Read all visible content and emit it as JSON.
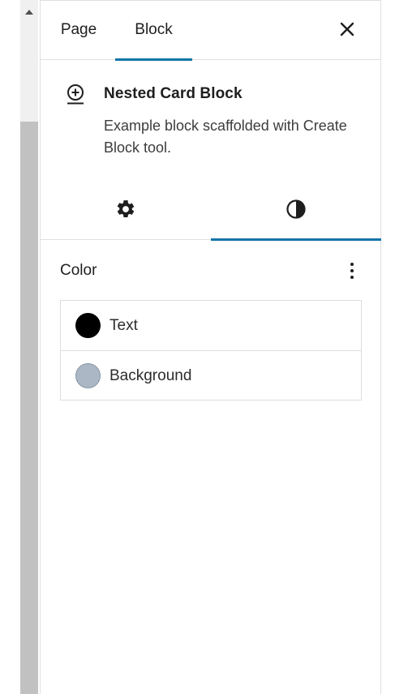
{
  "header": {
    "tabs": [
      {
        "label": "Page",
        "active": false
      },
      {
        "label": "Block",
        "active": true
      }
    ],
    "close_icon": "close-icon"
  },
  "block": {
    "icon": "plus-circle-icon",
    "title": "Nested Card Block",
    "description": "Example block scaffolded with Create Block tool."
  },
  "inspector_tabs": [
    {
      "icon": "gear-icon",
      "active": false
    },
    {
      "icon": "contrast-icon",
      "active": true
    }
  ],
  "color_panel": {
    "title": "Color",
    "menu_icon": "more-vertical-icon",
    "items": [
      {
        "label": "Text",
        "swatch": "#000000"
      },
      {
        "label": "Background",
        "swatch": "#abb7c4"
      }
    ]
  },
  "colors": {
    "accent": "#1275a8",
    "border": "#e0e0e0"
  }
}
